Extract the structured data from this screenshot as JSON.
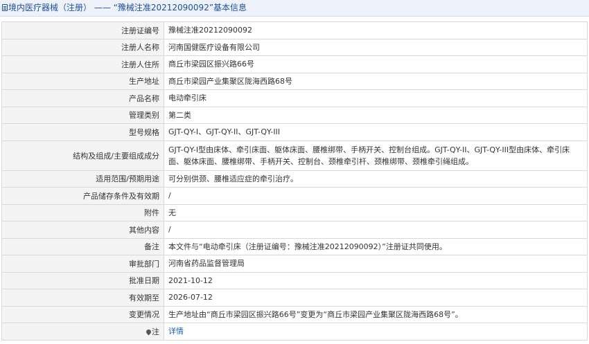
{
  "header": {
    "title": "境内医疗器械（注册） —— “豫械注准20212090092”基本信息"
  },
  "rows": [
    {
      "label": "注册证编号",
      "value": "豫械注准20212090092"
    },
    {
      "label": "注册人名称",
      "value": "河南国健医疗设备有限公司"
    },
    {
      "label": "注册人住所",
      "value": "商丘市梁园区振兴路66号"
    },
    {
      "label": "生产地址",
      "value": "商丘市梁园产业集聚区陇海西路68号"
    },
    {
      "label": "产品名称",
      "value": "电动牵引床"
    },
    {
      "label": "管理类别",
      "value": "第二类"
    },
    {
      "label": "型号规格",
      "value": "GJT-QY-I、GJT-QY-II、GJT-QY-III"
    },
    {
      "label": "结构及组成/主要组成成分",
      "value": "GJT-QY-I型由床体、牵引床面、躯体床面、腰椎绑带、手柄开关、控制台组成。GJT-QY-II、GJT-QY-III型由床体、牵引床面、躯体床面、腰椎绑带、手柄开关、控制台、颈椎牵引杆、颈椎绑带、颈椎牵引绳组成。"
    },
    {
      "label": "适用范围/预期用途",
      "value": "可分别供颈、腰椎适应症的牵引治疗。"
    },
    {
      "label": "产品储存条件及有效期",
      "value": "/"
    },
    {
      "label": "附件",
      "value": "无"
    },
    {
      "label": "其他内容",
      "value": "/"
    },
    {
      "label": "备注",
      "value": "本文件与“电动牵引床（注册证编号：豫械注准20212090092）”注册证共同使用。"
    },
    {
      "label": "审批部门",
      "value": "河南省药品监督管理局"
    },
    {
      "label": "批准日期",
      "value": "2021-10-12"
    },
    {
      "label": "有效期至",
      "value": "2026-07-12"
    },
    {
      "label": "变更情况",
      "value": "生产地址由“商丘市梁园区振兴路66号”变更为“商丘市梁园产业集聚区陇海西路68号”。"
    }
  ],
  "note_row": {
    "label": "注",
    "link_text": "详情"
  }
}
